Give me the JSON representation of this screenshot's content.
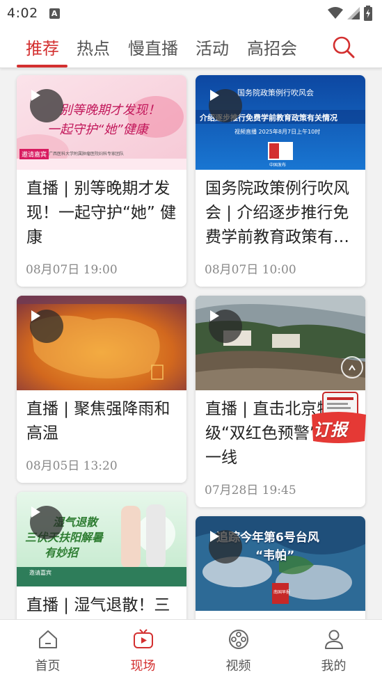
{
  "status_bar": {
    "time": "4:02",
    "notification_icon": "a-icon",
    "icons": [
      "wifi-icon",
      "signal-icon",
      "battery-charging-icon"
    ]
  },
  "tabs": [
    {
      "label": "推荐",
      "active": true
    },
    {
      "label": "热点",
      "active": false
    },
    {
      "label": "慢直播",
      "active": false
    },
    {
      "label": "活动",
      "active": false
    },
    {
      "label": "高招会",
      "active": false
    }
  ],
  "cards": [
    {
      "title": "直播 | 别等晚期才发现！一起守护“她” 健康",
      "date": "08月07日 19:00",
      "thumb_text": [
        "别等晚期才发现！",
        "一起守护“她”健康",
        "邀请嘉宾",
        "广西医科大学附属肿瘤医院妇科专家团队"
      ]
    },
    {
      "title": "国务院政策例行吹风会 | 介绍逐步推行免费学前教育政策有关情况",
      "date": "08月07日 10:00",
      "thumb_text": [
        "国务院政策例行吹风会",
        "介绍逐步推行免费学前教育政策有关情况",
        "视频直播 2025年8月7日上午10时",
        "中国发布"
      ]
    },
    {
      "title": "直播 | 聚焦强降雨和高温",
      "date": "08月05日 13:20",
      "thumb_text": []
    },
    {
      "title": "直播 | 直击北京特级“双红色预警”防灾一线",
      "date": "07月28日 19:45",
      "thumb_text": []
    },
    {
      "title": "直播 | 湿气退散！三伏天扶阳解暑有妙招",
      "date": "",
      "thumb_text": [
        "湿气退散",
        "三伏天扶阳解暑",
        "有妙招",
        "邀请嘉宾"
      ]
    },
    {
      "title": "",
      "date": "",
      "thumb_text": [
        "追踪今年第6号台风",
        "“韦帕”",
        "南国早报"
      ]
    }
  ],
  "subscribe_badge": {
    "label": "订报"
  },
  "bottom_nav": [
    {
      "label": "首页",
      "icon": "home-icon",
      "active": false
    },
    {
      "label": "现场",
      "icon": "tv-play-icon",
      "active": true
    },
    {
      "label": "视频",
      "icon": "film-reel-icon",
      "active": false
    },
    {
      "label": "我的",
      "icon": "person-icon",
      "active": false
    }
  ],
  "colors": {
    "accent": "#d32f2f",
    "background": "#f2f2f2"
  }
}
